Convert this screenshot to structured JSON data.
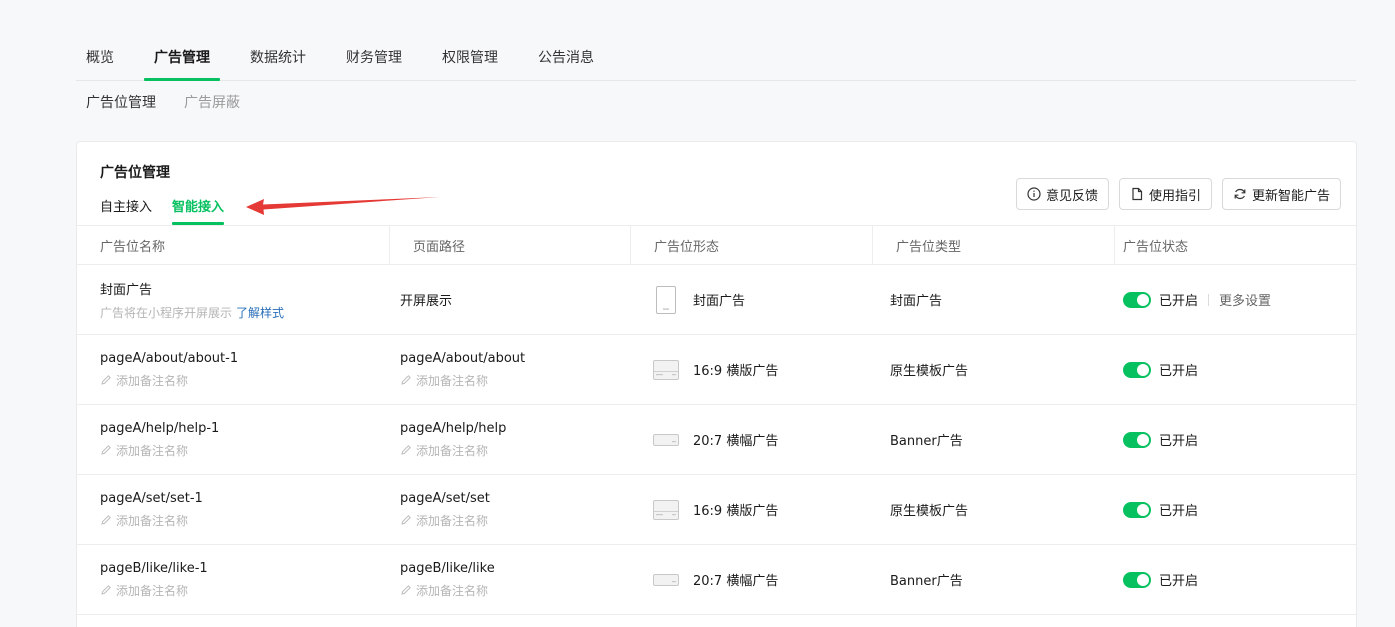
{
  "top_nav": [
    "概览",
    "广告管理",
    "数据统计",
    "财务管理",
    "权限管理",
    "公告消息"
  ],
  "top_nav_active": 1,
  "sub_nav": [
    "广告位管理",
    "广告屏蔽"
  ],
  "card": {
    "title": "广告位管理",
    "modes": [
      "自主接入",
      "智能接入"
    ],
    "active_mode": 1,
    "actions": [
      {
        "label": "意见反馈",
        "icon": "info-circle-icon"
      },
      {
        "label": "使用指引",
        "icon": "document-icon"
      },
      {
        "label": "更新智能广告",
        "icon": "refresh-icon"
      }
    ]
  },
  "accent_color": "#07c160",
  "annotation_color": "#e53935",
  "table": {
    "headers": [
      "广告位名称",
      "页面路径",
      "广告位形态",
      "广告位类型",
      "广告位状态"
    ],
    "note_placeholder": "添加备注名称",
    "rows": [
      {
        "name": "封面广告",
        "desc": "广告将在小程序开屏展示",
        "desc_link": "了解样式",
        "path": "开屏展示",
        "shape_icon": "phone-portrait-icon",
        "shape": "封面广告",
        "type": "封面广告",
        "status": "已开启",
        "enabled": true,
        "more": "更多设置"
      },
      {
        "name": "pageA/about/about-1",
        "note": "添加备注名称",
        "path": "pageA/about/about",
        "path_note": "添加备注名称",
        "shape_icon": "landscape-card-icon",
        "shape": "16:9 横版广告",
        "type": "原生模板广告",
        "status": "已开启",
        "enabled": true
      },
      {
        "name": "pageA/help/help-1",
        "note": "添加备注名称",
        "path": "pageA/help/help",
        "path_note": "添加备注名称",
        "shape_icon": "banner-strip-icon",
        "shape": "20:7 横幅广告",
        "type": "Banner广告",
        "status": "已开启",
        "enabled": true
      },
      {
        "name": "pageA/set/set-1",
        "note": "添加备注名称",
        "path": "pageA/set/set",
        "path_note": "添加备注名称",
        "shape_icon": "landscape-card-icon",
        "shape": "16:9 横版广告",
        "type": "原生模板广告",
        "status": "已开启",
        "enabled": true
      },
      {
        "name": "pageB/like/like-1",
        "note": "添加备注名称",
        "path": "pageB/like/like",
        "path_note": "添加备注名称",
        "shape_icon": "banner-strip-icon",
        "shape": "20:7 横幅广告",
        "type": "Banner广告",
        "status": "已开启",
        "enabled": true
      }
    ]
  }
}
